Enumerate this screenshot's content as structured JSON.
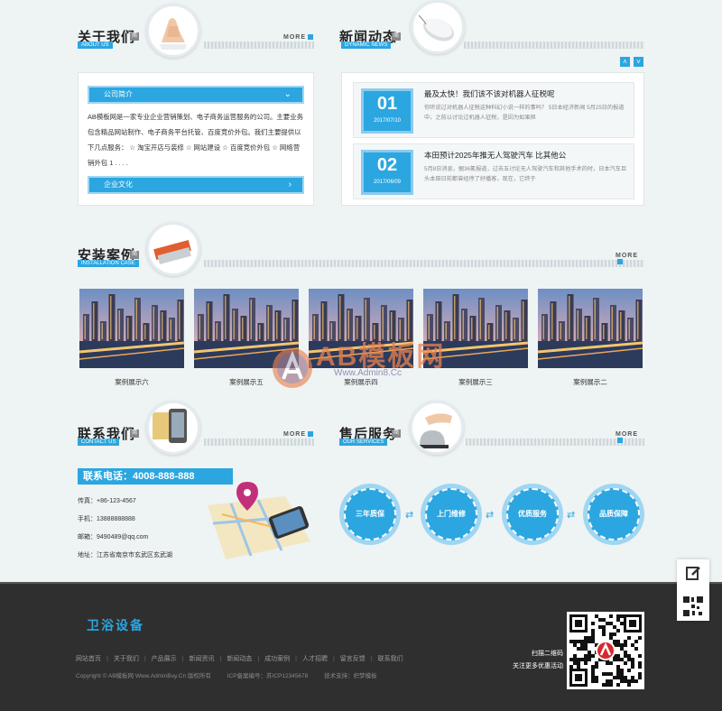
{
  "about": {
    "title": "关于我们",
    "subtitle": "ABOUT US",
    "badge": "简",
    "more": "MORE",
    "bar1": "公司简介",
    "bar2": "企业文化",
    "text": "AB模板网是一家专业企业营销策划、电子商务运营服务的公司。主要业务包含精品网站制作、电子商务平台托管、百度竞价外包。我们主要提供以下几点服务：  ☆ 淘宝开店与装修  ☆ 网站建设 ☆ 百度竞价外包 ☆ 网络营销外包 1 . . . ."
  },
  "news": {
    "title": "新闻动态",
    "subtitle": "DYNAMIC NEWS",
    "badge": "简",
    "items": [
      {
        "day": "01",
        "ym": "2017/07/10",
        "title": "最及太快！我们该不该对机器人征税呢",
        "summary": "你听说过对机器人征税这种科幻小说一样的事吗？ 5日本经济新闻 5月25日的报道中，之前以讨论过机器人征税，是因为如果担"
      },
      {
        "day": "02",
        "ym": "2017/06/09",
        "title": "本田预计2025年推无人驾驶汽车 比其他公",
        "summary": "5月8日消息，据36氪报道，过去五讨论无人驾驶汽车和其他手术的时，日本汽车巨头本田日前都曾经停了好播客，现在，它终于"
      }
    ]
  },
  "cases": {
    "title": "安装案例",
    "subtitle": "INSTALLATION CASE",
    "badge": "简",
    "more": "MORE",
    "items": [
      "案例展示六",
      "案例展示五",
      "案例展示四",
      "案例展示三",
      "案例展示二"
    ]
  },
  "contact": {
    "title": "联系我们",
    "subtitle": "CONTACT US",
    "badge": "简",
    "more": "MORE",
    "phone_bar": "联系电话：4008-888-888",
    "fax": "传真：+86-123-4567",
    "mobile": "手机：13888888888",
    "email": "邮箱：9490489@qq.com",
    "address": "地址：江苏省南京市玄武区玄武湖"
  },
  "service": {
    "title": "售后服务",
    "subtitle": "OUR SERVICES",
    "badge": "简",
    "more": "MORE",
    "items": [
      "三年质保",
      "上门维修",
      "优质服务",
      "品质保障"
    ]
  },
  "watermark": {
    "brand": "AB模板网",
    "url": "Www.Admin8.Cc"
  },
  "footer": {
    "logo": "卫浴设备",
    "nav": [
      "网站首页",
      "关于我们",
      "产品展示",
      "新闻资讯",
      "新闻动态",
      "成功案例",
      "人才招聘",
      "留言反馈",
      "联系我们"
    ],
    "copyright": "Copyright © AB模板网 Www.AdminBuy.Cn 版权所有",
    "icp": "ICP备案编号：苏ICP12345678",
    "support": "技术支持：织梦模板",
    "qr_line1": "扫描二维码",
    "qr_line2": "关注更多优惠活动"
  },
  "colors": {
    "accent": "#2ba6e0",
    "footer_bg": "#2f2f2f",
    "page_bg": "#eef3f4"
  }
}
